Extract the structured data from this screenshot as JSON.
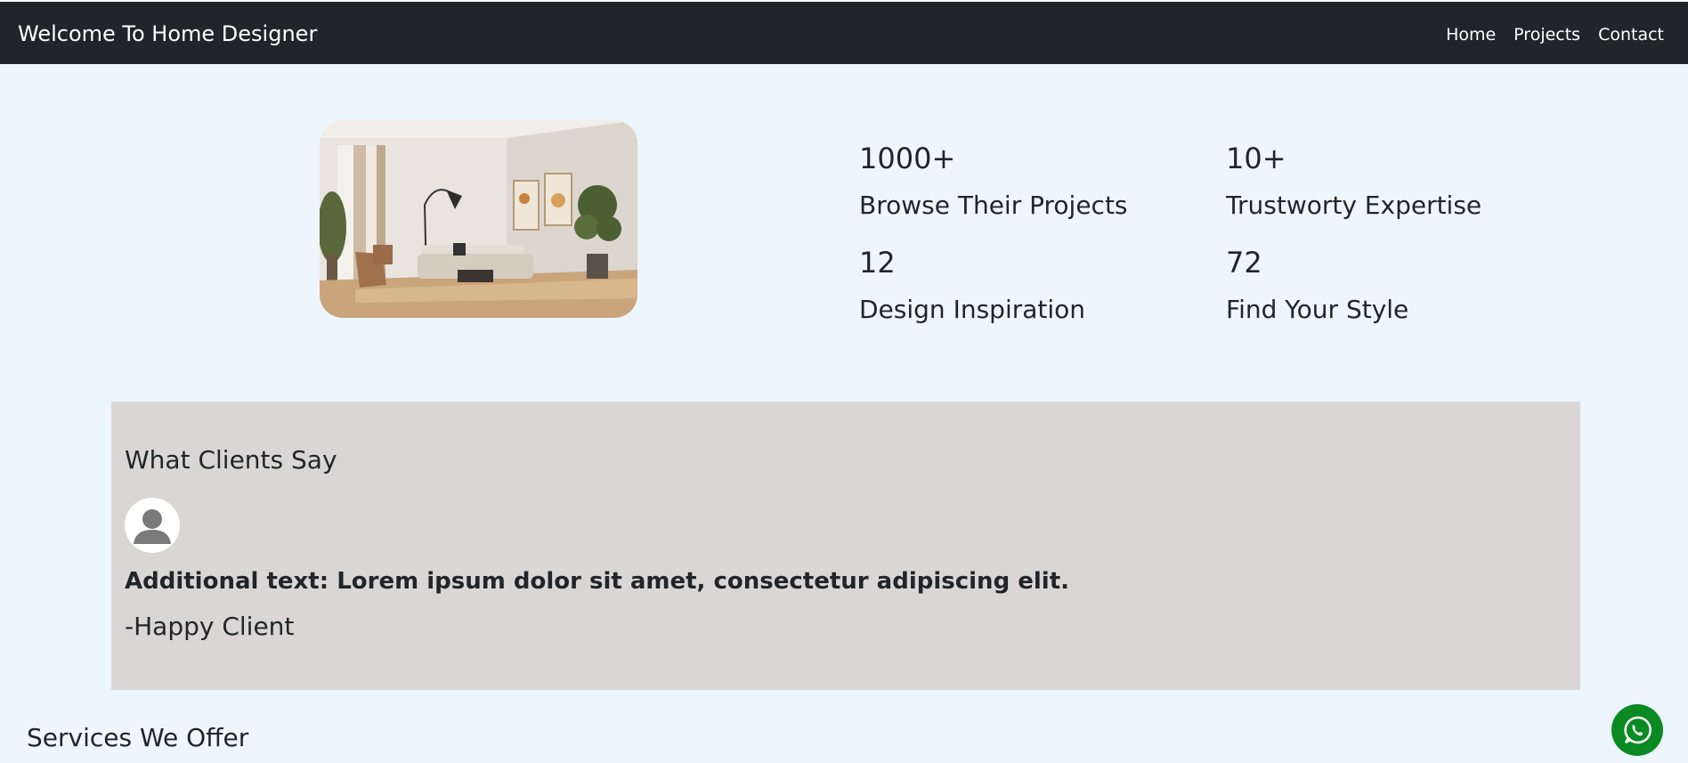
{
  "navbar": {
    "brand": "Welcome To Home Designer",
    "links": [
      "Home",
      "Projects",
      "Contact"
    ]
  },
  "hero": {
    "image_alt": "living room interior",
    "stats": [
      {
        "value": "1000+",
        "label": "Browse Their Projects"
      },
      {
        "value": "10+",
        "label": "Trustworty Expertise"
      },
      {
        "value": "12",
        "label": "Design Inspiration"
      },
      {
        "value": "72",
        "label": "Find Your Style"
      }
    ]
  },
  "testimonial": {
    "heading": "What Clients Say",
    "avatar_icon": "user-avatar-icon",
    "text": "Additional text: Lorem ipsum dolor sit amet, consectetur adipiscing elit.",
    "author": "-Happy Client"
  },
  "services": {
    "heading": "Services We Offer"
  },
  "floating": {
    "whatsapp_icon": "whatsapp-icon"
  },
  "colors": {
    "page_bg": "#eef6fd",
    "navbar_bg": "#212529",
    "testimonial_bg": "#dad6d6",
    "whatsapp_green": "#0a8a23"
  }
}
